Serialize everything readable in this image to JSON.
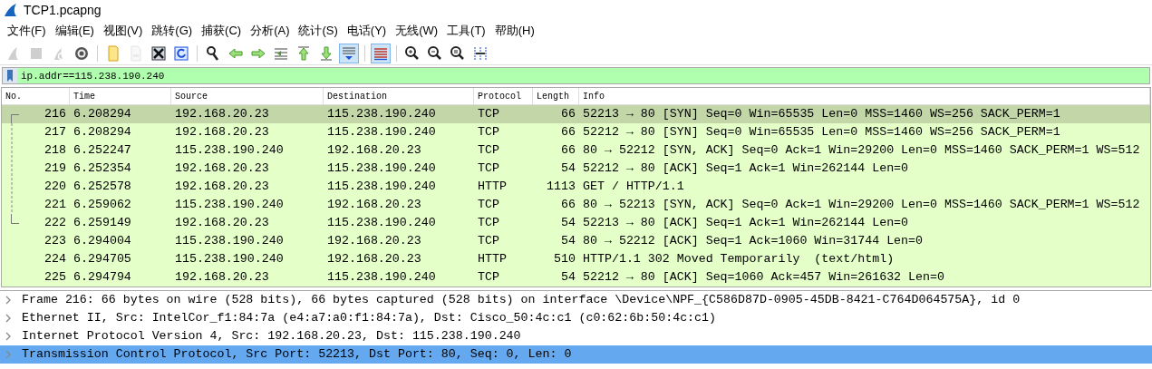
{
  "window": {
    "title": "TCP1.pcapng"
  },
  "menu": [
    "文件(F)",
    "编辑(E)",
    "视图(V)",
    "跳转(G)",
    "捕获(C)",
    "分析(A)",
    "统计(S)",
    "电话(Y)",
    "无线(W)",
    "工具(T)",
    "帮助(H)"
  ],
  "toolbar": [
    {
      "kind": "shark",
      "disabled": true,
      "on": false
    },
    {
      "kind": "stop",
      "disabled": true,
      "on": false
    },
    {
      "kind": "restart",
      "disabled": true,
      "on": false
    },
    {
      "kind": "options",
      "disabled": false,
      "on": false
    },
    {
      "kind": "sep"
    },
    {
      "kind": "open",
      "disabled": false,
      "on": false
    },
    {
      "kind": "save",
      "disabled": true,
      "on": false
    },
    {
      "kind": "close",
      "disabled": false,
      "on": false
    },
    {
      "kind": "reload",
      "disabled": false,
      "on": false
    },
    {
      "kind": "sep"
    },
    {
      "kind": "find",
      "disabled": false,
      "on": false
    },
    {
      "kind": "back",
      "disabled": false,
      "on": false
    },
    {
      "kind": "forward",
      "disabled": false,
      "on": false
    },
    {
      "kind": "goto",
      "disabled": false,
      "on": false
    },
    {
      "kind": "first",
      "disabled": false,
      "on": false
    },
    {
      "kind": "last",
      "disabled": false,
      "on": false
    },
    {
      "kind": "autoscroll",
      "disabled": false,
      "on": true
    },
    {
      "kind": "sep"
    },
    {
      "kind": "colorize",
      "disabled": false,
      "on": true
    },
    {
      "kind": "sep"
    },
    {
      "kind": "zoomin",
      "disabled": false,
      "on": false
    },
    {
      "kind": "zoomout",
      "disabled": false,
      "on": false
    },
    {
      "kind": "zoomreset",
      "disabled": false,
      "on": false
    },
    {
      "kind": "resize",
      "disabled": false,
      "on": false
    }
  ],
  "filter": {
    "value": "ip.addr==115.238.190.240"
  },
  "table": {
    "columns": [
      "No.",
      "Time",
      "Source",
      "Destination",
      "Protocol",
      "Length",
      "Info"
    ],
    "rows": [
      {
        "cells": [
          "216",
          "6.208294",
          "192.168.20.23",
          "115.238.190.240",
          "TCP",
          "66",
          "52213 → 80 [SYN] Seq=0 Win=65535 Len=0 MSS=1460 WS=256 SACK_PERM=1"
        ],
        "selected": true,
        "kind": "related-first"
      },
      {
        "cells": [
          "217",
          "6.208294",
          "192.168.20.23",
          "115.238.190.240",
          "TCP",
          "66",
          "52212 → 80 [SYN] Seq=0 Win=65535 Len=0 MSS=1460 WS=256 SACK_PERM=1"
        ],
        "selected": false,
        "kind": "related-middle"
      },
      {
        "cells": [
          "218",
          "6.252247",
          "115.238.190.240",
          "192.168.20.23",
          "TCP",
          "66",
          "80 → 52212 [SYN, ACK] Seq=0 Ack=1 Win=29200 Len=0 MSS=1460 SACK_PERM=1 WS=512"
        ],
        "selected": false,
        "kind": "related-middle"
      },
      {
        "cells": [
          "219",
          "6.252354",
          "192.168.20.23",
          "115.238.190.240",
          "TCP",
          "54",
          "52212 → 80 [ACK] Seq=1 Ack=1 Win=262144 Len=0"
        ],
        "selected": false,
        "kind": "related-middle"
      },
      {
        "cells": [
          "220",
          "6.252578",
          "192.168.20.23",
          "115.238.190.240",
          "HTTP",
          "1113",
          "GET / HTTP/1.1"
        ],
        "selected": false,
        "kind": "related-middle"
      },
      {
        "cells": [
          "221",
          "6.259062",
          "115.238.190.240",
          "192.168.20.23",
          "TCP",
          "66",
          "80 → 52213 [SYN, ACK] Seq=0 Ack=1 Win=29200 Len=0 MSS=1460 SACK_PERM=1 WS=512"
        ],
        "selected": false,
        "kind": "related-middle"
      },
      {
        "cells": [
          "222",
          "6.259149",
          "192.168.20.23",
          "115.238.190.240",
          "TCP",
          "54",
          "52213 → 80 [ACK] Seq=1 Ack=1 Win=262144 Len=0"
        ],
        "selected": false,
        "kind": "related-last"
      },
      {
        "cells": [
          "223",
          "6.294004",
          "115.238.190.240",
          "192.168.20.23",
          "TCP",
          "54",
          "80 → 52212 [ACK] Seq=1 Ack=1060 Win=31744 Len=0"
        ],
        "selected": false,
        "kind": "plain"
      },
      {
        "cells": [
          "224",
          "6.294705",
          "115.238.190.240",
          "192.168.20.23",
          "HTTP",
          "510",
          "HTTP/1.1 302 Moved Temporarily  (text/html)"
        ],
        "selected": false,
        "kind": "plain"
      },
      {
        "cells": [
          "225",
          "6.294794",
          "192.168.20.23",
          "115.238.190.240",
          "TCP",
          "54",
          "52212 → 80 [ACK] Seq=1060 Ack=457 Win=261632 Len=0"
        ],
        "selected": false,
        "kind": "plain"
      }
    ]
  },
  "details": [
    {
      "text": "Frame 216: 66 bytes on wire (528 bits), 66 bytes captured (528 bits) on interface \\Device\\NPF_{C586D87D-0905-45DB-8421-C764D064575A}, id 0",
      "expanded": false,
      "selected": false
    },
    {
      "text": "Ethernet II, Src: IntelCor_f1:84:7a (e4:a7:a0:f1:84:7a), Dst: Cisco_50:4c:c1 (c0:62:6b:50:4c:c1)",
      "expanded": false,
      "selected": false
    },
    {
      "text": "Internet Protocol Version 4, Src: 192.168.20.23, Dst: 115.238.190.240",
      "expanded": false,
      "selected": false
    },
    {
      "text": "Transmission Control Protocol, Src Port: 52213, Dst Port: 80, Seq: 0, Len: 0",
      "expanded": false,
      "selected": true
    }
  ]
}
